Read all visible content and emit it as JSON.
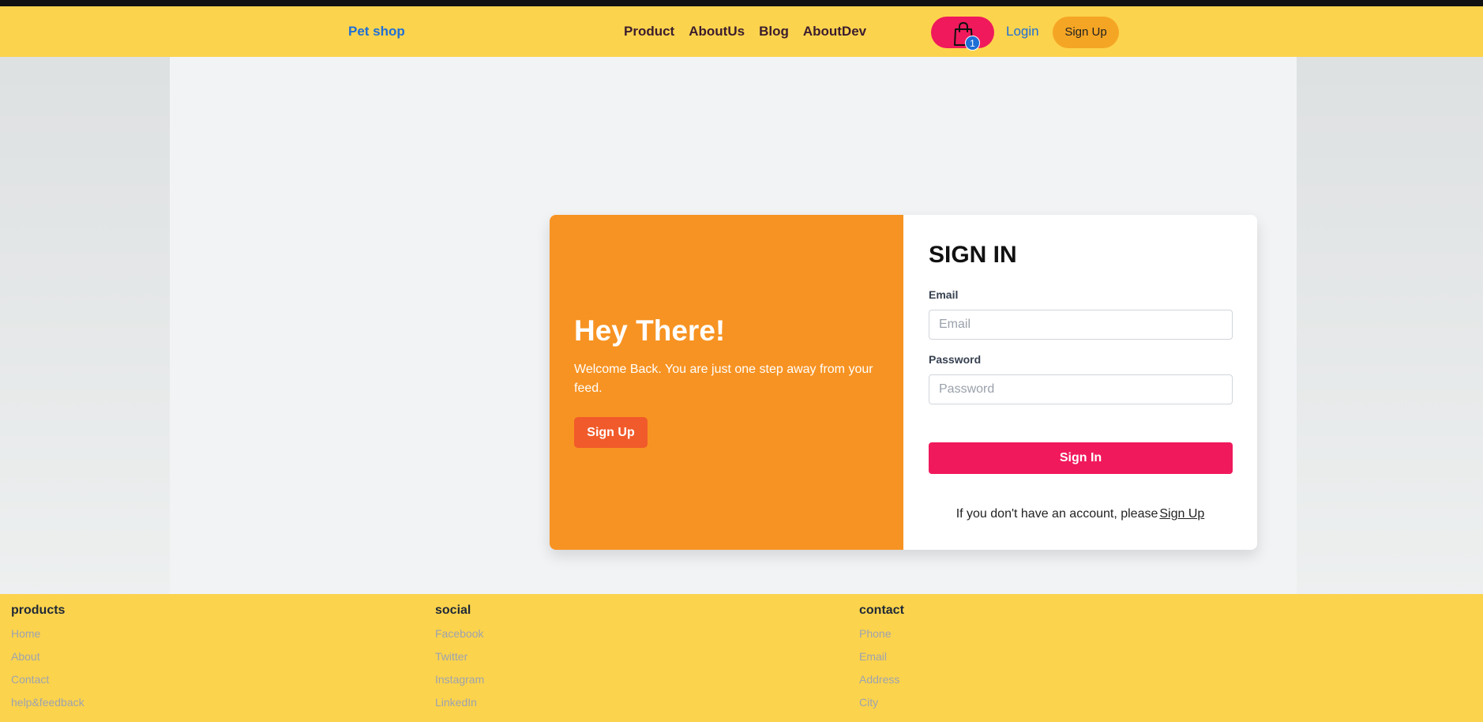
{
  "navbar": {
    "brand": "Pet shop",
    "links": [
      "Product",
      "AboutUs",
      "Blog",
      "AboutDev"
    ],
    "cart_count": "1",
    "login": "Login",
    "signup": "Sign Up"
  },
  "hero": {
    "title": "Hey There!",
    "text": "Welcome Back. You are just one step away from your feed.",
    "signup": "Sign Up"
  },
  "signin": {
    "title": "SIGN IN",
    "email_label": "Email",
    "email_placeholder": "Email",
    "password_label": "Password",
    "password_placeholder": "Password",
    "button": "Sign In",
    "account_text": "If you don't have an account, please",
    "account_link": "Sign Up"
  },
  "footer": {
    "columns": [
      {
        "heading": "products",
        "links": [
          "Home",
          "About",
          "Contact",
          "help&feedback"
        ]
      },
      {
        "heading": "social",
        "links": [
          "Facebook",
          "Twitter",
          "Instagram",
          "LinkedIn"
        ]
      },
      {
        "heading": "contact",
        "links": [
          "Phone",
          "Email",
          "Address",
          "City"
        ]
      }
    ]
  },
  "colors": {
    "navbar_bg": "#fcd34d",
    "accent_pink": "#f0195c",
    "hero_orange": "#f79322",
    "link_blue": "#1e6fd6"
  }
}
